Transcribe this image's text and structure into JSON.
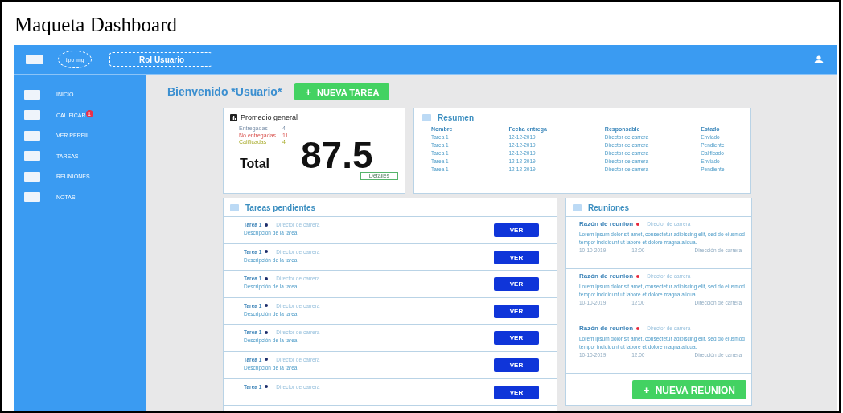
{
  "document": {
    "title": "Maqueta Dashboard"
  },
  "topbar": {
    "logo_placeholder": "tipo img",
    "role": "Rol Usuario"
  },
  "sidebar": {
    "items": [
      {
        "label": "INICIO"
      },
      {
        "label": "CALIFICAR",
        "badge": "1"
      },
      {
        "label": "VER PERFIL"
      },
      {
        "label": "TAREAS"
      },
      {
        "label": "REUNIONES"
      },
      {
        "label": "NOTAS"
      }
    ]
  },
  "welcome": {
    "title": "Bienvenido *Usuario*",
    "button": "NUEVA TAREA",
    "button_icon": "+"
  },
  "promedio": {
    "title": "Promedio general",
    "stats": [
      {
        "label": "Entregadas",
        "value": "4",
        "kind": "delivered"
      },
      {
        "label": "No entregadas",
        "value": "11",
        "kind": "missing"
      },
      {
        "label": "Calificadas",
        "value": "4",
        "kind": "graded"
      }
    ],
    "total_label": "Total",
    "total": "87.5",
    "details": "Detalles"
  },
  "resumen": {
    "title": "Resumen",
    "columns": [
      "Nombre",
      "Fecha entrega",
      "Responsable",
      "Estado"
    ],
    "rows": [
      [
        "Tarea 1",
        "12-12-2019",
        "Director de carrera",
        "Enviado"
      ],
      [
        "Tarea 1",
        "12-12-2019",
        "Director de carrera",
        "Pendiente"
      ],
      [
        "Tarea 1",
        "12-12-2019",
        "Director de carrera",
        "Calificado"
      ],
      [
        "Tarea 1",
        "12-12-2019",
        "Director de carrera",
        "Enviado"
      ],
      [
        "Tarea 1",
        "12-12-2019",
        "Director de carrera",
        "Pendiente"
      ]
    ]
  },
  "tareas": {
    "title": "Tareas pendientes",
    "items": [
      {
        "name": "Tarea 1",
        "responsible": "Director de carrera",
        "description": "Descripción de la tarea",
        "button": "VER"
      },
      {
        "name": "Tarea 1",
        "responsible": "Director de carrera",
        "description": "Descripción de la tarea",
        "button": "VER"
      },
      {
        "name": "Tarea 1",
        "responsible": "Director de carrera",
        "description": "Descripción de la tarea",
        "button": "VER"
      },
      {
        "name": "Tarea 1",
        "responsible": "Director de carrera",
        "description": "Descripción de la tarea",
        "button": "VER"
      },
      {
        "name": "Tarea 1",
        "responsible": "Director de carrera",
        "description": "Descripción de la tarea",
        "button": "VER"
      },
      {
        "name": "Tarea 1",
        "responsible": "Director de carrera",
        "description": "Descripción de la tarea",
        "button": "VER"
      },
      {
        "name": "Tarea 1",
        "responsible": "Director de carrera",
        "button": "VER"
      }
    ]
  },
  "reuniones": {
    "title": "Reuniones",
    "items": [
      {
        "reason": "Razón de reunion",
        "responsible": "Director de carrera",
        "text": "Lorem ipsum dolor sit amet, consectetur adipiscing elit, sed do eiusmod tempor incididunt ut labore et dolore magna aliqua.",
        "date": "10-10-2019",
        "time": "12:00",
        "place": "Dirección de carrera"
      },
      {
        "reason": "Razón de reunion",
        "responsible": "Director de carrera",
        "text": "Lorem ipsum dolor sit amet, consectetur adipiscing elit, sed do eiusmod tempor incididunt ut labore et dolore magna aliqua.",
        "date": "10-10-2019",
        "time": "12:00",
        "place": "Dirección de carrera"
      },
      {
        "reason": "Razón de reunion",
        "responsible": "Director de carrera",
        "text": "Lorem ipsum dolor sit amet, consectetur adipiscing elit, sed do eiusmod tempor incididunt ut labore et dolore magna aliqua.",
        "date": "10-10-2019",
        "time": "12:00",
        "place": "Dirección de carrera"
      }
    ],
    "button": "NUEVA REUNION",
    "button_icon": "+"
  }
}
